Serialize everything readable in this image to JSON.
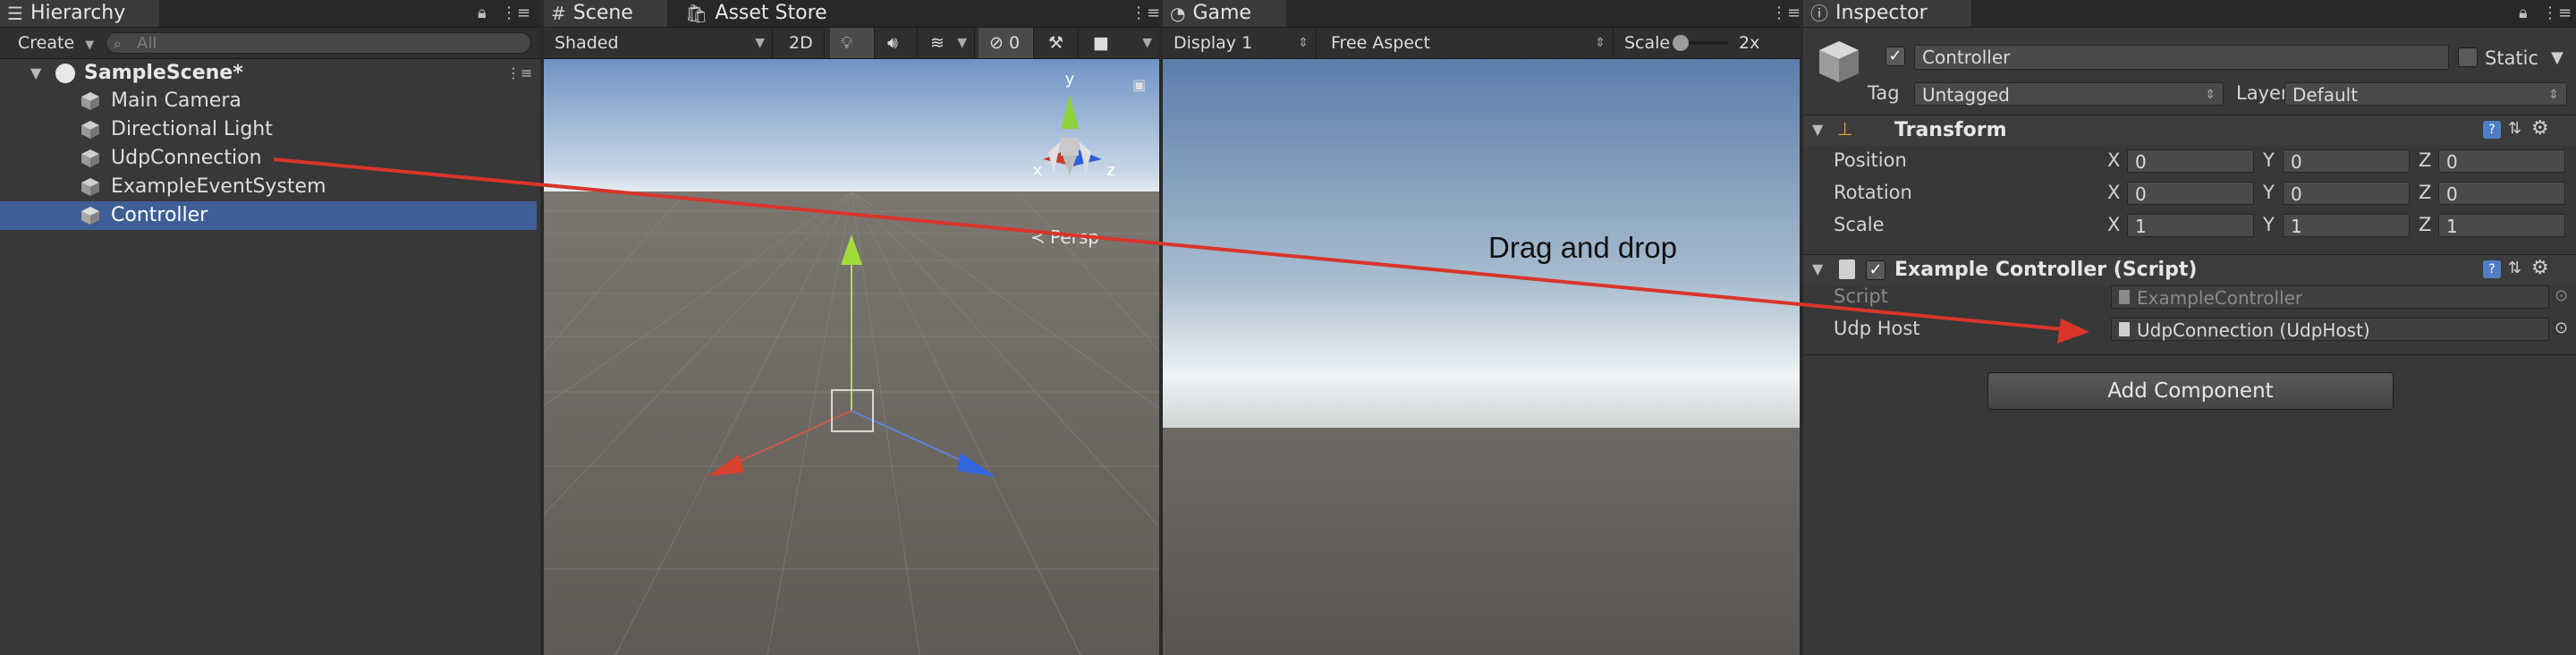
{
  "hierarchy": {
    "tab_label": "Hierarchy",
    "create_label": "Create",
    "search_placeholder": "All",
    "scene_name": "SampleScene*",
    "items": [
      {
        "label": "Main Camera"
      },
      {
        "label": "Directional Light"
      },
      {
        "label": "UdpConnection"
      },
      {
        "label": "ExampleEventSystem"
      },
      {
        "label": "Controller"
      }
    ]
  },
  "scene": {
    "tab_label": "Scene",
    "asset_store_tab": "Asset Store",
    "shading_mode": "Shaded",
    "mode_2d": "2D",
    "hidden_count": "0",
    "persp_label": "Persp",
    "gizmo_y": "y",
    "gizmo_x": "x",
    "gizmo_z": "z"
  },
  "game": {
    "tab_label": "Game",
    "display": "Display 1",
    "aspect": "Free Aspect",
    "scale_label": "Scale",
    "scale_value": "2x"
  },
  "inspector": {
    "tab_label": "Inspector",
    "object_name": "Controller",
    "static_label": "Static",
    "tag_label": "Tag",
    "tag_value": "Untagged",
    "layer_label": "Layer",
    "layer_value": "Default",
    "transform": {
      "title": "Transform",
      "position_label": "Position",
      "rotation_label": "Rotation",
      "scale_label": "Scale",
      "axis_x": "X",
      "axis_y": "Y",
      "axis_z": "Z",
      "position": [
        "0",
        "0",
        "0"
      ],
      "rotation": [
        "0",
        "0",
        "0"
      ],
      "scale": [
        "1",
        "1",
        "1"
      ]
    },
    "script_component": {
      "title": "Example Controller (Script)",
      "script_label": "Script",
      "script_value": "ExampleController",
      "udp_host_label": "Udp Host",
      "udp_host_value": "UdpConnection (UdpHost)"
    },
    "add_component_label": "Add Component"
  },
  "annotation": {
    "text": "Drag and drop",
    "arrow_color": "#d9352a"
  },
  "colors": {
    "selection": "#3e5f96",
    "panel_bg": "#383838",
    "tab_bg": "#282828",
    "gizmo_y": "#8dd13c",
    "gizmo_x": "#d8432c",
    "gizmo_z": "#3366dd"
  }
}
